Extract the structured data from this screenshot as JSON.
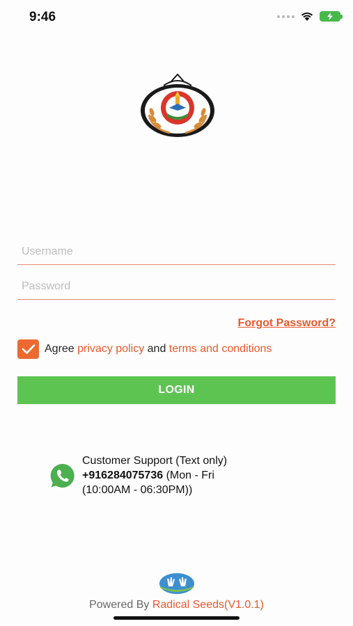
{
  "status_bar": {
    "time": "9:46",
    "icons": [
      "signal-dots-icon",
      "wifi-icon",
      "battery-charging-icon"
    ],
    "battery_color": "#49b84a"
  },
  "login": {
    "username_placeholder": "Username",
    "password_placeholder": "Password",
    "forgot_password": "Forgot Password?",
    "agree_prefix": "Agree",
    "privacy_policy": "privacy policy",
    "and_text": "and",
    "terms": "terms and conditions",
    "agree_checked": true,
    "login_label": "LOGIN"
  },
  "support": {
    "line1": "Customer Support (Text only)",
    "phone": "+916284075736",
    "hours_part1": "(Mon - Fri",
    "hours_part2": "(10:00AM - 06:30PM))"
  },
  "footer": {
    "powered_by": "Powered By",
    "brand": "Radical Seeds(V1.0.1)"
  },
  "colors": {
    "accent_orange": "#e8592a",
    "field_underline": "#e98575",
    "login_green": "#5dc452",
    "whatsapp_green": "#4caf50"
  }
}
